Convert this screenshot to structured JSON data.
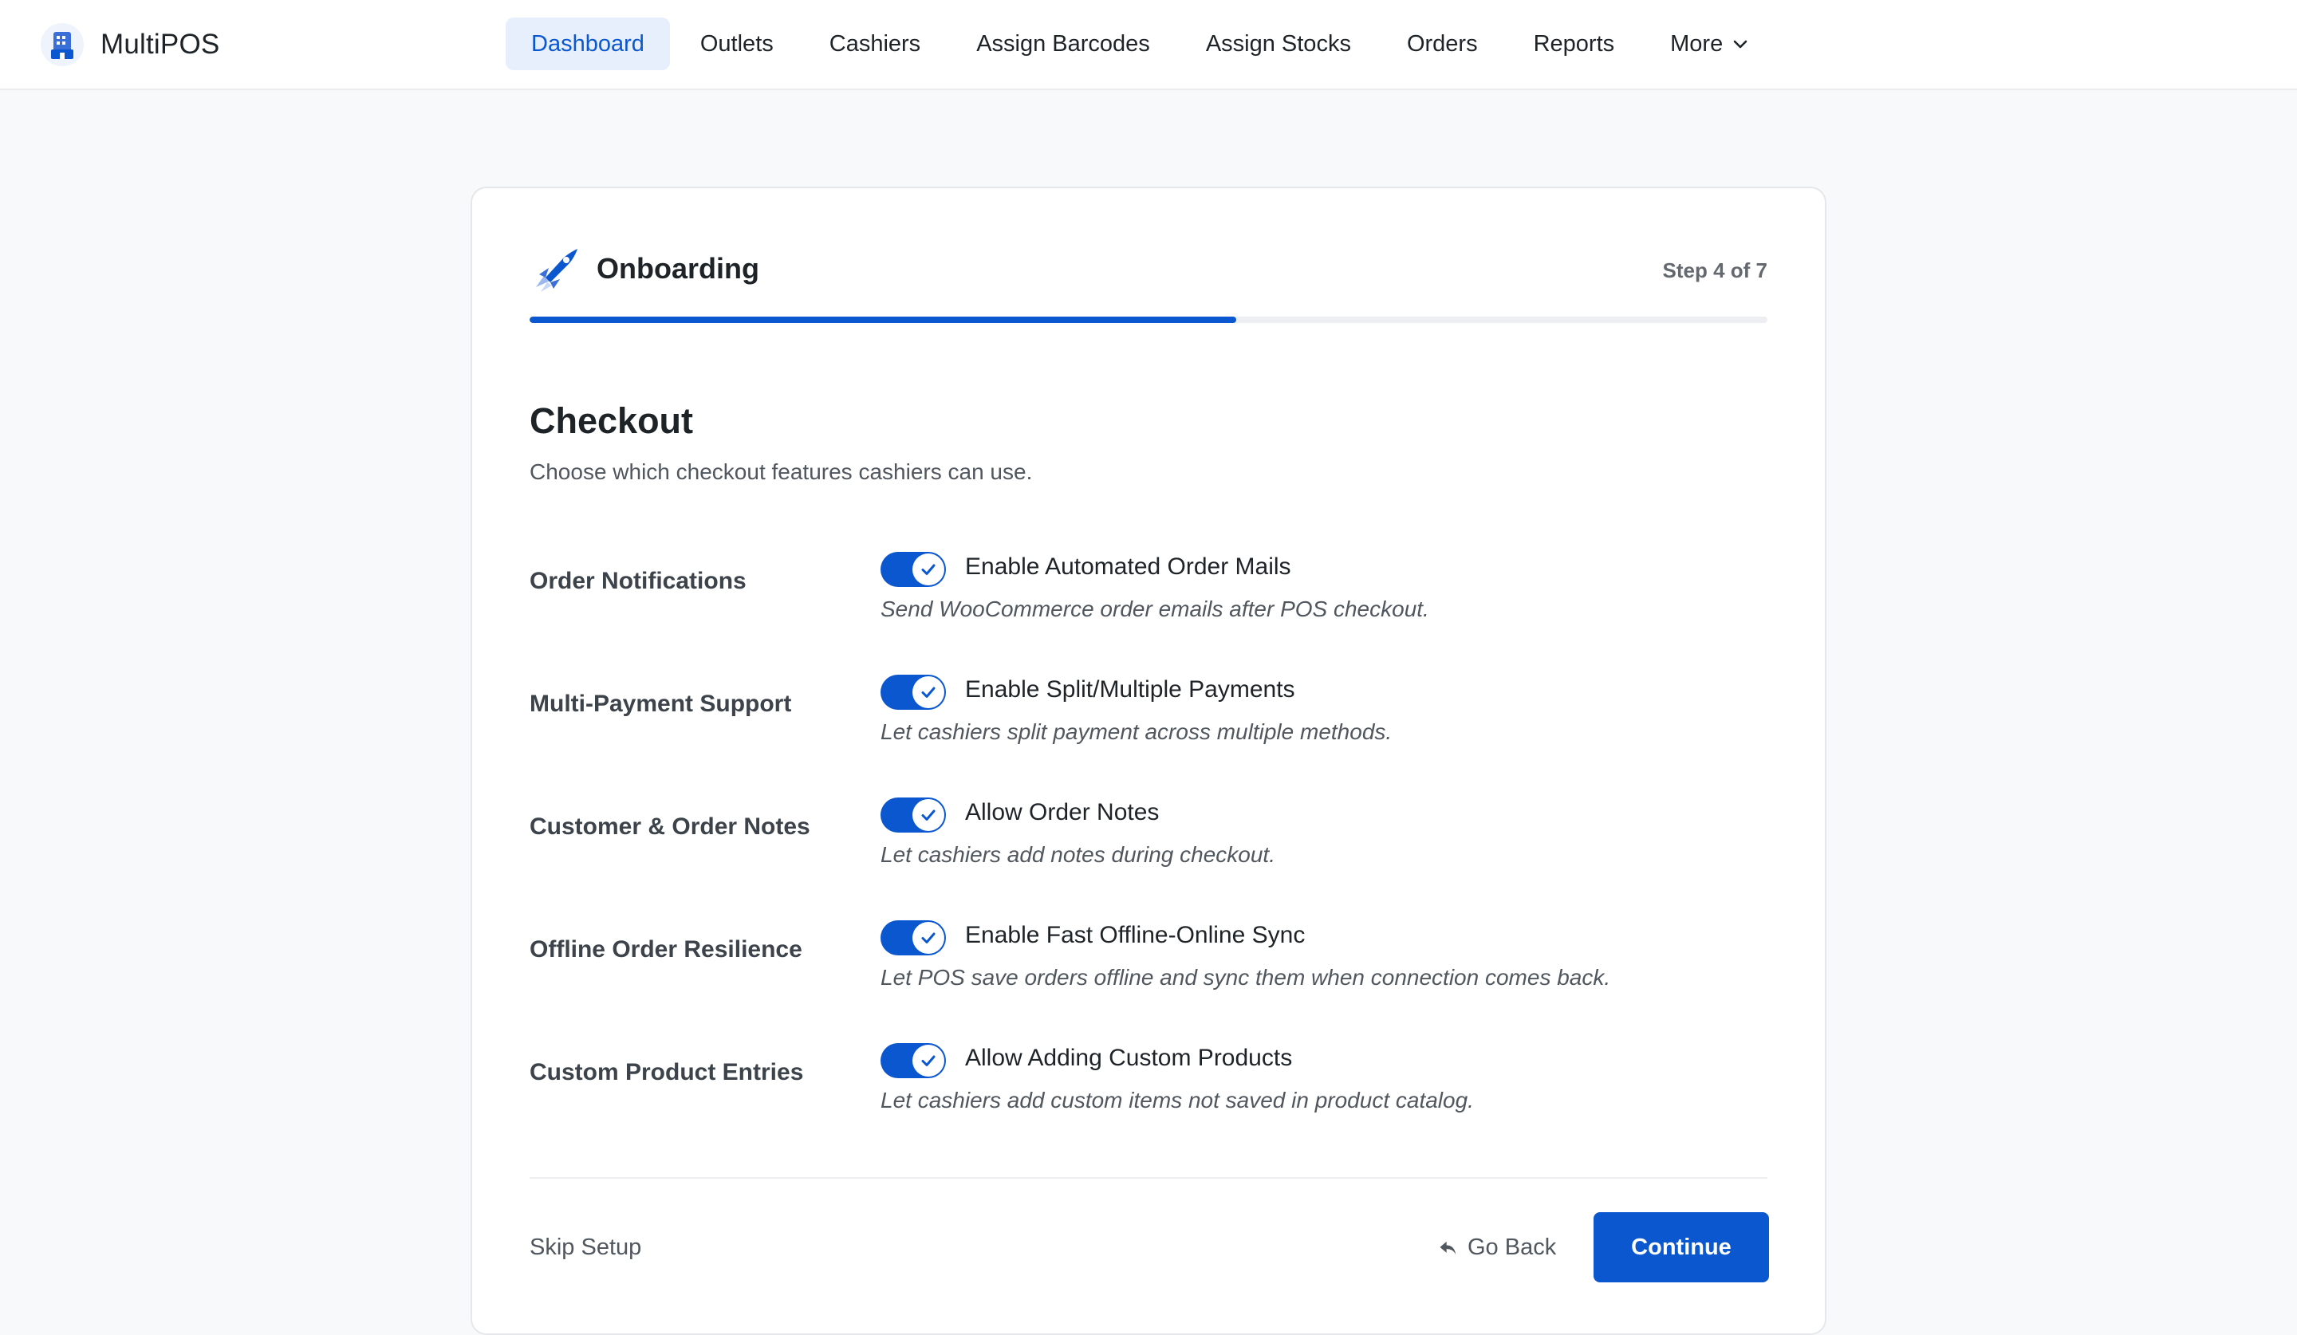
{
  "app": {
    "name": "MultiPOS",
    "logo_icon": "storefront-logo-icon",
    "accent": "#0b57d0"
  },
  "nav": {
    "items": [
      {
        "label": "Dashboard",
        "active": true
      },
      {
        "label": "Outlets"
      },
      {
        "label": "Cashiers"
      },
      {
        "label": "Assign Barcodes"
      },
      {
        "label": "Assign Stocks"
      },
      {
        "label": "Orders"
      },
      {
        "label": "Reports"
      },
      {
        "label": "More",
        "icon": "chevron-down-icon"
      }
    ]
  },
  "onboarding": {
    "title": "Onboarding",
    "icon": "rocket-icon",
    "step_text": "Step 4 of 7",
    "progress": 0.571
  },
  "section": {
    "title": "Checkout",
    "description": "Choose which checkout features cashiers can use."
  },
  "settings": [
    {
      "label": "Order Notifications",
      "option": "Enable Automated Order Mails",
      "help": "Send WooCommerce order emails after POS checkout.",
      "enabled": true
    },
    {
      "label": "Multi-Payment Support",
      "option": "Enable Split/Multiple Payments",
      "help": "Let cashiers split payment across multiple methods.",
      "enabled": true
    },
    {
      "label": "Customer & Order Notes",
      "option": "Allow Order Notes",
      "help": "Let cashiers add notes during checkout.",
      "enabled": true
    },
    {
      "label": "Offline Order Resilience",
      "option": "Enable Fast Offline-Online Sync",
      "help": "Let POS save orders offline and sync them when connection comes back.",
      "enabled": true
    },
    {
      "label": "Custom Product Entries",
      "option": "Allow Adding Custom Products",
      "help": "Let cashiers add custom items not saved in product catalog.",
      "enabled": true
    }
  ],
  "footer": {
    "skip_label": "Skip Setup",
    "back_label": "Go Back",
    "back_icon": "reply-arrow-icon",
    "continue_label": "Continue"
  }
}
